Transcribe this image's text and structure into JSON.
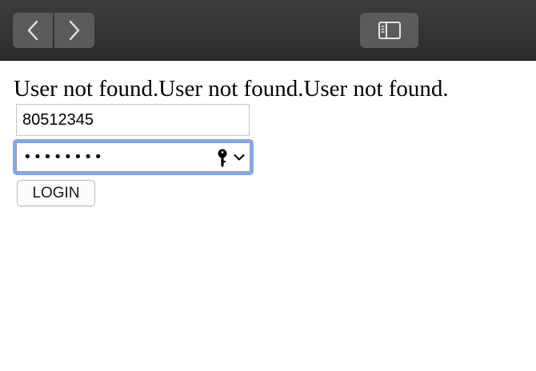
{
  "toolbar": {
    "back_icon": "chevron-left-icon",
    "forward_icon": "chevron-right-icon",
    "sidebar_icon": "sidebar-icon",
    "background_color": "#2c2c2e",
    "button_color": "#5b5b5e"
  },
  "main": {
    "message": "User not found.User not found.User not found.",
    "username_value": "80512345",
    "password_mask": "••••••••",
    "password_icons": [
      "key-icon",
      "chevron-down-icon"
    ],
    "focus_color": "#7faaf0",
    "login_label": "LOGIN"
  }
}
